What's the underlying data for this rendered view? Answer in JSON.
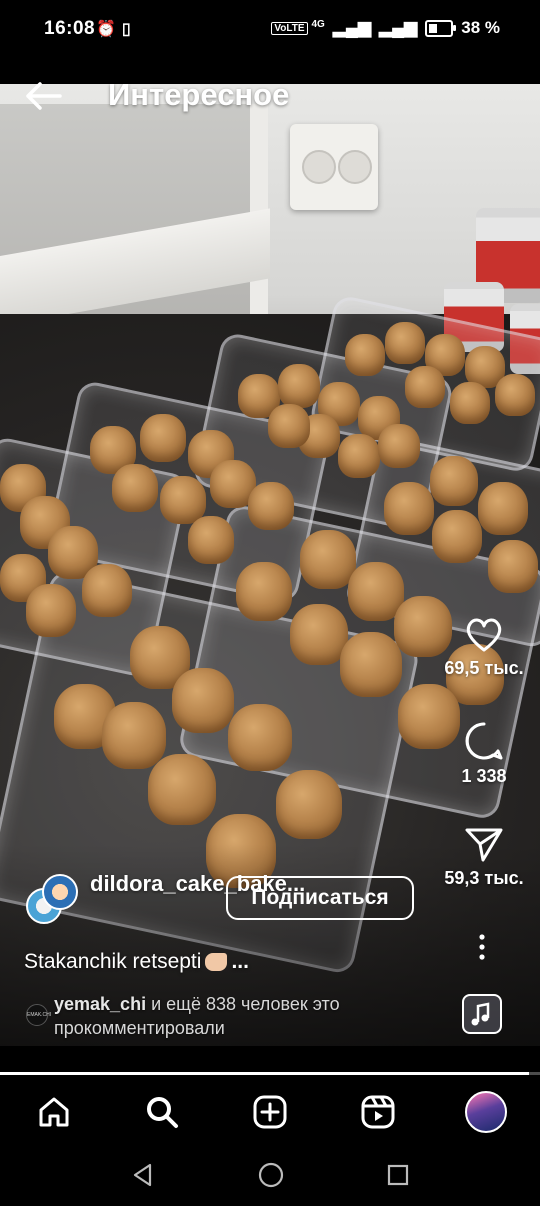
{
  "status_bar": {
    "time": "16:08",
    "left_icons": [
      "alarm-icon",
      "vibrate-icon"
    ],
    "volte": "VoLTE",
    "network": "4G",
    "battery_percent_label": "38 %",
    "battery_level": 0.38
  },
  "header": {
    "back_icon": "arrow-left-icon",
    "title": "Интересное"
  },
  "actions": {
    "like_count": "69,5 тыс.",
    "comment_count": "1 338",
    "share_count": "59,3 тыс."
  },
  "post": {
    "author": "dildora_cake_bake...",
    "follow_label": "Подписаться",
    "caption": "Stakanchik retsepti",
    "caption_more": "...",
    "commenter_name": "yemak_chi",
    "commenter_avatar_text": "EMAK.CHI",
    "comments_text": "и ещё 838 человек это прокомментировали"
  },
  "video_progress": 0.98,
  "bottom_nav": [
    "home-icon",
    "search-icon",
    "create-post-icon",
    "reels-icon",
    "profile-avatar"
  ],
  "system_nav": [
    "back-triangle-icon",
    "home-circle-icon",
    "recents-square-icon"
  ],
  "colors": {
    "background": "#000000",
    "text": "#ffffff"
  }
}
